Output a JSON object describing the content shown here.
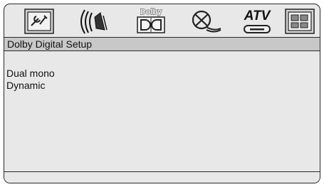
{
  "icons": [
    {
      "name": "general-setup-icon",
      "selected": false
    },
    {
      "name": "audio-setup-icon",
      "selected": false
    },
    {
      "name": "dolby-digital-setup-icon",
      "label": "Dolby",
      "selected": true
    },
    {
      "name": "video-off-icon",
      "selected": false
    },
    {
      "name": "atv-icon",
      "label": "ATV",
      "selected": false
    },
    {
      "name": "preferences-icon",
      "selected": false
    }
  ],
  "header": {
    "title": "Dolby Digital Setup"
  },
  "menu": {
    "items": [
      {
        "label": "Dual mono"
      },
      {
        "label": "Dynamic"
      }
    ]
  },
  "colors": {
    "panel_bg": "#e8e8e8",
    "header_bg": "#c8c8c8",
    "border": "#2a2a2a"
  }
}
